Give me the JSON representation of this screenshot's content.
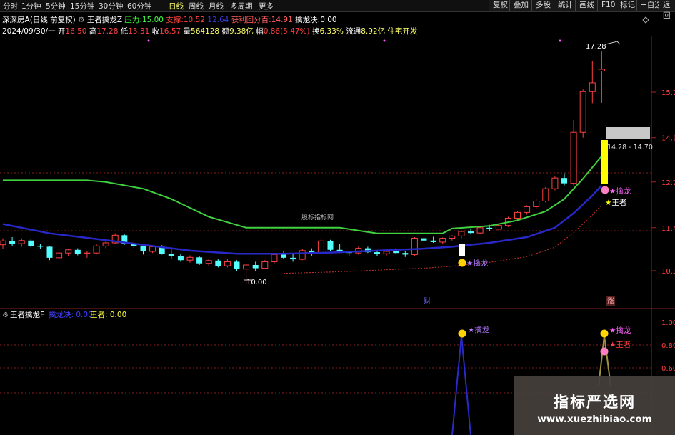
{
  "toolbar": {
    "timeframes": [
      "分时",
      "1分钟",
      "5分钟",
      "15分钟",
      "30分钟",
      "60分钟",
      "日线",
      "周线",
      "月线",
      "多周期",
      "更多"
    ],
    "selected": "日线",
    "buttons": [
      "复权",
      "叠加",
      "多股",
      "统计",
      "画线",
      "F10",
      "标记",
      "+自选",
      "返回"
    ]
  },
  "header": {
    "stock": "深深房A",
    "mode": "(日线 前复权)",
    "indicator": "王者擒龙Z",
    "pressure_label": "压力:",
    "pressure_value": "15.00",
    "support_label": "支撑:",
    "support_value": "10.52",
    "support_value2": "12.64",
    "profit_label": "获利回分百:",
    "profit_value": "14.91",
    "capture_label": "擒龙决:",
    "capture_value": "0.00",
    "date": "2024/09/30/一",
    "open_label": "开",
    "open": "16.50",
    "high_label": "高",
    "high": "17.28",
    "low_label": "低",
    "low": "15.31",
    "close_label": "收",
    "close": "16.57",
    "volume_label": "量",
    "volume": "564128",
    "amount_label": "额",
    "amount": "9.38亿",
    "change_label": "幅",
    "change": "0.86(5.47%)",
    "turnover_label": "换",
    "turnover": "6.33%",
    "float_label": "流通",
    "float": "8.92亿",
    "sector": "住宅开发"
  },
  "chart_data": [
    {
      "type": "candlestick",
      "title": "王者擒龙Z",
      "y_ticks": [
        "15.7",
        "14.1",
        "12.7",
        "11.4",
        "10.3"
      ],
      "annotations": {
        "high_label": "17.28",
        "low_label": "10.00",
        "range_label": "14.28 - 14.70",
        "center_watermark": "股标指标网",
        "marker_left": "擒龙",
        "marker_right_top": "擒龙",
        "marker_right_bottom": "王者",
        "bottom_left_tag": "财",
        "bottom_right_tag": "涨"
      },
      "candles": [
        {
          "o": 10.95,
          "h": 11.12,
          "l": 10.85,
          "c": 11.05
        },
        {
          "o": 11.05,
          "h": 11.15,
          "l": 10.92,
          "c": 10.97
        },
        {
          "o": 10.98,
          "h": 11.12,
          "l": 10.9,
          "c": 11.06
        },
        {
          "o": 11.06,
          "h": 11.1,
          "l": 10.88,
          "c": 10.92
        },
        {
          "o": 10.92,
          "h": 10.98,
          "l": 10.84,
          "c": 10.9
        },
        {
          "o": 10.9,
          "h": 10.92,
          "l": 10.56,
          "c": 10.62
        },
        {
          "o": 10.62,
          "h": 10.78,
          "l": 10.58,
          "c": 10.74
        },
        {
          "o": 10.74,
          "h": 10.85,
          "l": 10.66,
          "c": 10.82
        },
        {
          "o": 10.82,
          "h": 10.86,
          "l": 10.68,
          "c": 10.72
        },
        {
          "o": 10.72,
          "h": 10.8,
          "l": 10.62,
          "c": 10.74
        },
        {
          "o": 10.74,
          "h": 10.96,
          "l": 10.7,
          "c": 10.92
        },
        {
          "o": 10.92,
          "h": 11.08,
          "l": 10.86,
          "c": 11.0
        },
        {
          "o": 11.0,
          "h": 11.25,
          "l": 10.98,
          "c": 11.2
        },
        {
          "o": 11.2,
          "h": 11.22,
          "l": 10.95,
          "c": 10.98
        },
        {
          "o": 10.98,
          "h": 11.02,
          "l": 10.86,
          "c": 10.92
        },
        {
          "o": 10.92,
          "h": 10.96,
          "l": 10.7,
          "c": 10.78
        },
        {
          "o": 10.78,
          "h": 10.92,
          "l": 10.74,
          "c": 10.9
        },
        {
          "o": 10.9,
          "h": 10.94,
          "l": 10.7,
          "c": 10.72
        },
        {
          "o": 10.72,
          "h": 10.85,
          "l": 10.6,
          "c": 10.66
        },
        {
          "o": 10.66,
          "h": 10.72,
          "l": 10.52,
          "c": 10.56
        },
        {
          "o": 10.56,
          "h": 10.68,
          "l": 10.5,
          "c": 10.63
        },
        {
          "o": 10.63,
          "h": 10.66,
          "l": 10.44,
          "c": 10.48
        },
        {
          "o": 10.48,
          "h": 10.58,
          "l": 10.42,
          "c": 10.55
        },
        {
          "o": 10.55,
          "h": 10.6,
          "l": 10.38,
          "c": 10.42
        },
        {
          "o": 10.42,
          "h": 10.58,
          "l": 10.38,
          "c": 10.52
        },
        {
          "o": 10.52,
          "h": 10.56,
          "l": 10.3,
          "c": 10.34
        },
        {
          "o": 10.34,
          "h": 10.48,
          "l": 10.0,
          "c": 10.44
        },
        {
          "o": 10.44,
          "h": 10.52,
          "l": 10.3,
          "c": 10.36
        },
        {
          "o": 10.36,
          "h": 10.56,
          "l": 10.34,
          "c": 10.52
        },
        {
          "o": 10.52,
          "h": 10.72,
          "l": 10.48,
          "c": 10.7
        },
        {
          "o": 10.7,
          "h": 10.8,
          "l": 10.58,
          "c": 10.62
        },
        {
          "o": 10.62,
          "h": 10.72,
          "l": 10.52,
          "c": 10.58
        },
        {
          "o": 10.58,
          "h": 10.85,
          "l": 10.56,
          "c": 10.8
        },
        {
          "o": 10.8,
          "h": 10.86,
          "l": 10.66,
          "c": 10.72
        },
        {
          "o": 10.72,
          "h": 11.1,
          "l": 10.7,
          "c": 11.05
        },
        {
          "o": 11.05,
          "h": 11.08,
          "l": 10.78,
          "c": 10.82
        },
        {
          "o": 10.82,
          "h": 10.98,
          "l": 10.74,
          "c": 10.76
        },
        {
          "o": 10.76,
          "h": 10.8,
          "l": 10.66,
          "c": 10.74
        },
        {
          "o": 10.74,
          "h": 10.9,
          "l": 10.7,
          "c": 10.86
        },
        {
          "o": 10.86,
          "h": 10.9,
          "l": 10.74,
          "c": 10.76
        },
        {
          "o": 10.76,
          "h": 10.8,
          "l": 10.66,
          "c": 10.72
        },
        {
          "o": 10.72,
          "h": 10.82,
          "l": 10.68,
          "c": 10.78
        },
        {
          "o": 10.78,
          "h": 10.86,
          "l": 10.72,
          "c": 10.74
        },
        {
          "o": 10.74,
          "h": 10.78,
          "l": 10.64,
          "c": 10.7
        },
        {
          "o": 10.7,
          "h": 11.15,
          "l": 10.66,
          "c": 11.12
        },
        {
          "o": 11.12,
          "h": 11.2,
          "l": 11.0,
          "c": 11.06
        },
        {
          "o": 11.06,
          "h": 11.16,
          "l": 11.0,
          "c": 11.02
        },
        {
          "o": 11.02,
          "h": 11.14,
          "l": 10.98,
          "c": 11.12
        },
        {
          "o": 11.12,
          "h": 11.2,
          "l": 11.06,
          "c": 11.18
        },
        {
          "o": 11.18,
          "h": 11.32,
          "l": 11.12,
          "c": 11.3
        },
        {
          "o": 11.3,
          "h": 11.38,
          "l": 11.22,
          "c": 11.26
        },
        {
          "o": 11.26,
          "h": 11.42,
          "l": 11.24,
          "c": 11.4
        },
        {
          "o": 11.4,
          "h": 11.48,
          "l": 11.32,
          "c": 11.36
        },
        {
          "o": 11.36,
          "h": 11.48,
          "l": 11.32,
          "c": 11.46
        },
        {
          "o": 11.46,
          "h": 11.7,
          "l": 11.42,
          "c": 11.66
        },
        {
          "o": 11.66,
          "h": 11.85,
          "l": 11.6,
          "c": 11.82
        },
        {
          "o": 11.82,
          "h": 12.02,
          "l": 11.76,
          "c": 11.98
        },
        {
          "o": 11.98,
          "h": 12.2,
          "l": 11.92,
          "c": 12.14
        },
        {
          "o": 12.14,
          "h": 12.55,
          "l": 12.1,
          "c": 12.5
        },
        {
          "o": 12.5,
          "h": 12.88,
          "l": 12.45,
          "c": 12.82
        },
        {
          "o": 12.82,
          "h": 12.96,
          "l": 12.6,
          "c": 12.66
        },
        {
          "o": 12.66,
          "h": 14.7,
          "l": 12.6,
          "c": 14.28
        },
        {
          "o": 14.28,
          "h": 15.8,
          "l": 14.1,
          "c": 15.72
        },
        {
          "o": 15.72,
          "h": 16.9,
          "l": 15.3,
          "c": 16.05
        },
        {
          "o": 16.5,
          "h": 17.28,
          "l": 15.31,
          "c": 16.57
        }
      ],
      "green_line": [
        [
          0,
          12.75
        ],
        [
          9,
          12.75
        ],
        [
          11,
          12.7
        ],
        [
          15,
          12.5
        ],
        [
          18,
          12.2
        ],
        [
          22,
          11.7
        ],
        [
          26,
          11.4
        ],
        [
          36,
          11.4
        ],
        [
          40,
          11.25
        ],
        [
          44,
          11.25
        ],
        [
          47,
          11.25
        ],
        [
          48,
          11.38
        ],
        [
          52,
          11.45
        ],
        [
          55,
          11.6
        ],
        [
          58,
          11.85
        ],
        [
          60,
          12.2
        ],
        [
          62,
          12.8
        ],
        [
          64,
          13.5
        ]
      ],
      "blue_line": [
        [
          0,
          11.5
        ],
        [
          5,
          11.25
        ],
        [
          10,
          11.1
        ],
        [
          15,
          10.95
        ],
        [
          20,
          10.8
        ],
        [
          25,
          10.72
        ],
        [
          30,
          10.72
        ],
        [
          35,
          10.75
        ],
        [
          40,
          10.8
        ],
        [
          45,
          10.85
        ],
        [
          48,
          10.9
        ],
        [
          52,
          11.0
        ],
        [
          56,
          11.15
        ],
        [
          59,
          11.4
        ],
        [
          61,
          11.8
        ],
        [
          63,
          12.3
        ],
        [
          64,
          12.6
        ]
      ]
    },
    {
      "type": "line",
      "title": "王者擒龙F",
      "series_labels": [
        "擒龙决: 0.00",
        "王者: 0.00"
      ],
      "y_ticks": [
        "1.00",
        "0.80",
        "0.60"
      ],
      "markers": [
        "擒龙",
        "擒龙",
        "王者"
      ]
    }
  ],
  "watermark": {
    "cn": "指标严选网",
    "url": "www.xuezhibiao.com"
  },
  "colors": {
    "up": "#ff4040",
    "down": "#54ffff",
    "green_line": "#40d040",
    "blue_line": "#2828c8",
    "yellow": "#ffff00",
    "magenta": "#ff60ff"
  }
}
